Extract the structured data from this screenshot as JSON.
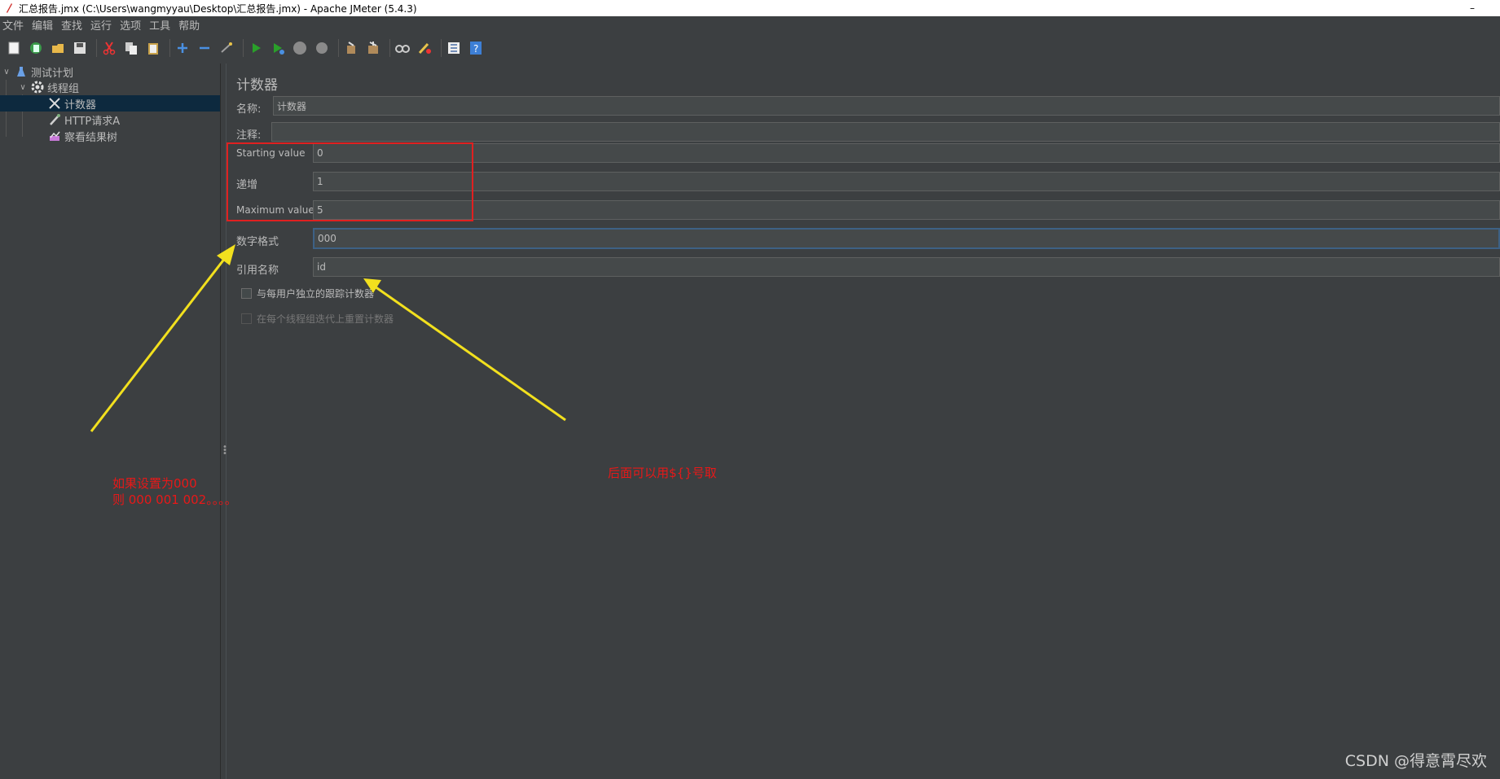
{
  "window": {
    "title": "汇总报告.jmx (C:\\Users\\wangmyyau\\Desktop\\汇总报告.jmx) - Apache JMeter (5.4.3)",
    "minimize_glyph": "–"
  },
  "menubar": [
    "文件",
    "编辑",
    "查找",
    "运行",
    "选项",
    "工具",
    "帮助"
  ],
  "toolbar": {
    "icons": [
      "new-icon",
      "templates-icon",
      "open-icon",
      "save-icon",
      "cut-icon",
      "copy-icon",
      "paste-icon",
      "expand-icon",
      "collapse-icon",
      "toggle-icon",
      "start-icon",
      "start-no-pause-icon",
      "stop-icon",
      "shutdown-icon",
      "clear-icon",
      "clear-all-icon",
      "search-icon",
      "reset-search-icon",
      "function-helper-icon",
      "help-icon"
    ]
  },
  "tree": {
    "items": [
      {
        "label": "测试计划",
        "icon": "test-plan-icon"
      },
      {
        "label": "线程组",
        "icon": "thread-group-gear-icon"
      },
      {
        "label": "计数器",
        "icon": "counter-tools-icon"
      },
      {
        "label": "HTTP请求A",
        "icon": "http-sampler-pipette-icon"
      },
      {
        "label": "察看结果树",
        "icon": "results-tree-icon"
      }
    ]
  },
  "panel": {
    "title": "计数器",
    "name_label": "名称:",
    "name_value": "计数器",
    "comment_label": "注释:",
    "comment_value": "",
    "fields": [
      {
        "label": "Starting value",
        "value": "0"
      },
      {
        "label": "递增",
        "value": "1"
      },
      {
        "label": "Maximum value",
        "value": "5"
      },
      {
        "label": "数字格式",
        "value": "000"
      },
      {
        "label": "引用名称",
        "value": "id"
      }
    ],
    "checkboxes": [
      {
        "label": "与每用户独立的跟踪计数器",
        "checked": false,
        "enabled": true
      },
      {
        "label": "在每个线程组迭代上重置计数器",
        "checked": false,
        "enabled": false
      }
    ]
  },
  "annotations": {
    "left_line1": "如果设置为000",
    "left_line2": "则 000  001 002。。。。",
    "right": "后面可以用${}号取"
  },
  "watermark": "CSDN @得意霄尽欢",
  "colors": {
    "background": "#3c3f41",
    "input_bg": "#45494a",
    "selection": "#0d293e",
    "annotation_red": "#e81818",
    "arrow_yellow": "#f2e01e"
  }
}
